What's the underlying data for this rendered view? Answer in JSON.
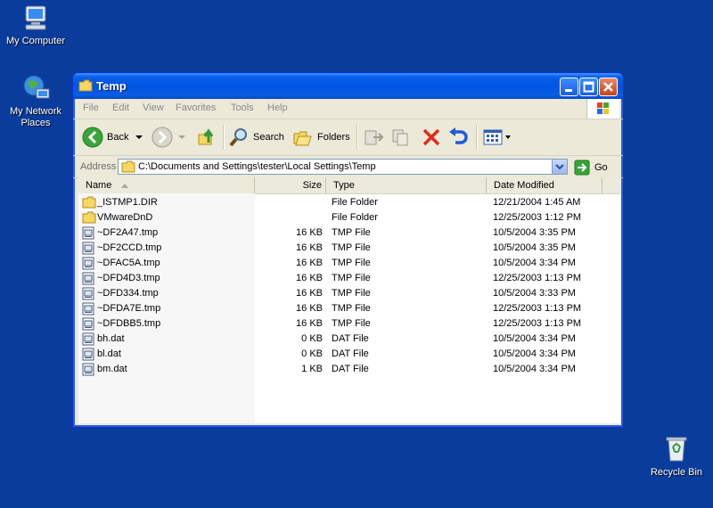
{
  "desktop": {
    "icons": [
      {
        "label": "My Computer",
        "icon": "computer-icon"
      },
      {
        "label": "My Network Places",
        "icon": "network-icon"
      },
      {
        "label": "Recycle Bin",
        "icon": "recycle-bin-icon"
      }
    ]
  },
  "window": {
    "title": "Temp",
    "menu": [
      "File",
      "Edit",
      "View",
      "Favorites",
      "Tools",
      "Help"
    ],
    "toolbar": {
      "back": "Back",
      "search": "Search",
      "folders": "Folders"
    },
    "address": {
      "label": "Address",
      "value": "C:\\Documents and Settings\\tester\\Local Settings\\Temp",
      "go": "Go"
    },
    "columns": [
      "Name",
      "Size",
      "Type",
      "Date Modified"
    ],
    "files": [
      {
        "name": "_ISTMP1.DIR",
        "size": "",
        "type": "File Folder",
        "date": "12/21/2004 1:45 AM",
        "kind": "folder"
      },
      {
        "name": "VMwareDnD",
        "size": "",
        "type": "File Folder",
        "date": "12/25/2003 1:12 PM",
        "kind": "folder"
      },
      {
        "name": "~DF2A47.tmp",
        "size": "16 KB",
        "type": "TMP File",
        "date": "10/5/2004 3:35 PM",
        "kind": "file"
      },
      {
        "name": "~DF2CCD.tmp",
        "size": "16 KB",
        "type": "TMP File",
        "date": "10/5/2004 3:35 PM",
        "kind": "file"
      },
      {
        "name": "~DFAC5A.tmp",
        "size": "16 KB",
        "type": "TMP File",
        "date": "10/5/2004 3:34 PM",
        "kind": "file"
      },
      {
        "name": "~DFD4D3.tmp",
        "size": "16 KB",
        "type": "TMP File",
        "date": "12/25/2003 1:13 PM",
        "kind": "file"
      },
      {
        "name": "~DFD334.tmp",
        "size": "16 KB",
        "type": "TMP File",
        "date": "10/5/2004 3:33 PM",
        "kind": "file"
      },
      {
        "name": "~DFDA7E.tmp",
        "size": "16 KB",
        "type": "TMP File",
        "date": "12/25/2003 1:13 PM",
        "kind": "file"
      },
      {
        "name": "~DFDBB5.tmp",
        "size": "16 KB",
        "type": "TMP File",
        "date": "12/25/2003 1:13 PM",
        "kind": "file"
      },
      {
        "name": "bh.dat",
        "size": "0 KB",
        "type": "DAT File",
        "date": "10/5/2004 3:34 PM",
        "kind": "file"
      },
      {
        "name": "bl.dat",
        "size": "0 KB",
        "type": "DAT File",
        "date": "10/5/2004 3:34 PM",
        "kind": "file"
      },
      {
        "name": "bm.dat",
        "size": "1 KB",
        "type": "DAT File",
        "date": "10/5/2004 3:34 PM",
        "kind": "file"
      }
    ]
  },
  "colors": {
    "desktop": "#0a3c9c",
    "titlebar": "#0054e3",
    "close": "#c8441a"
  }
}
